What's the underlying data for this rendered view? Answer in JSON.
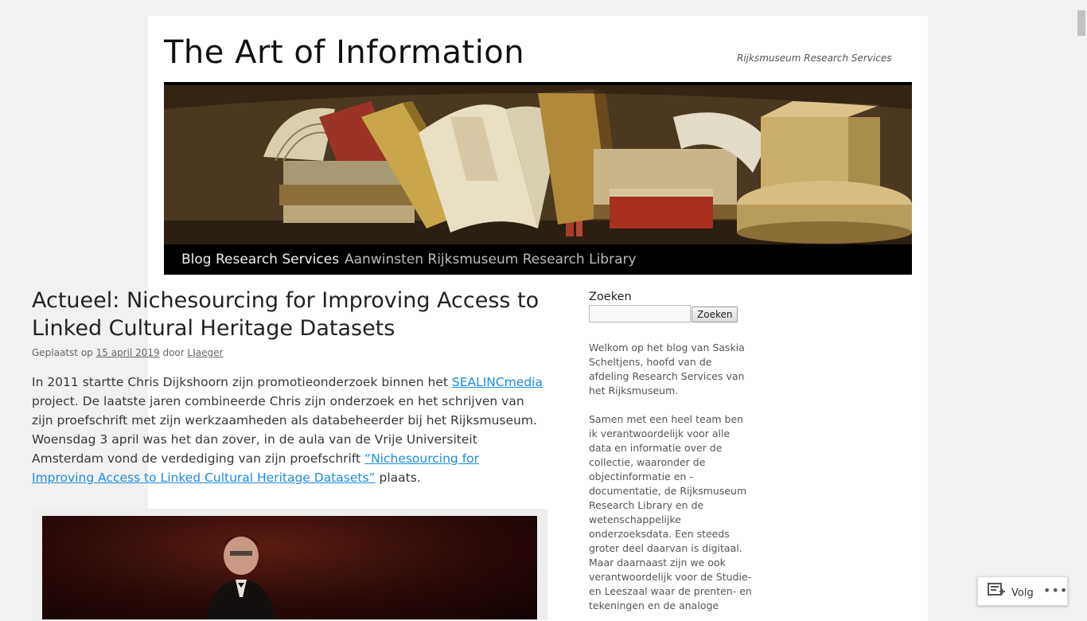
{
  "site": {
    "title": "The Art of Information",
    "description": "Rijksmuseum Research Services"
  },
  "nav": {
    "items": [
      {
        "label": "Blog Research Services"
      },
      {
        "label": "Aanwinsten Rijksmuseum Research Library"
      }
    ]
  },
  "post": {
    "title": "Actueel: Nichesourcing for Improving Access to Linked Cultural Heritage Datasets",
    "meta": {
      "posted_prefix": "Geplaatst op",
      "date": "15 april 2019",
      "by": "door",
      "author": "LJaeger"
    },
    "body": {
      "p1_a": "In 2011 startte Chris Dijkshoorn zijn promotieonderzoek binnen het",
      "p1_link": "SEALINCmedia",
      "p1_b": "project. De laatste jaren combineerde Chris zijn onderzoek en het schrijven van zijn proefschrift met zijn werkzaamheden als databeheerder bij het Rijksmuseum. Woensdag 3 april was het dan zover, in de aula van de Vrije Universiteit Amsterdam vond de verdediging van zijn proefschrift",
      "p1_link2": "“Nichesourcing for Improving Access to Linked Cultural Heritage Datasets”",
      "p1_c": "plaats."
    }
  },
  "sidebar": {
    "search_title": "Zoeken",
    "search_placeholder": "",
    "search_button": "Zoeken",
    "intro_1": "Welkom op het blog van Saskia Scheltjens, hoofd van de afdeling Research Services van het Rijksmuseum.",
    "intro_2": "Samen met een heel team ben ik verantwoordelijk voor alle data en informatie over de collectie, waaronder de objectinformatie en -documentatie, de Rijksmuseum Research Library en de wetenschappelijke onderzoeksdata. Een steeds groter deel daarvan is digitaal. Maar daarnaast zijn we ook verantwoordelijk voor de Studie- en Leeszaal waar de prenten- en tekeningen en de analoge"
  },
  "follow": {
    "label": "Volg",
    "icon": "follow-reader-icon",
    "more": "•••"
  },
  "colors": {
    "page_bg": "#f1f1f1",
    "nav_bg": "#000000",
    "link": "#1b8be0"
  }
}
